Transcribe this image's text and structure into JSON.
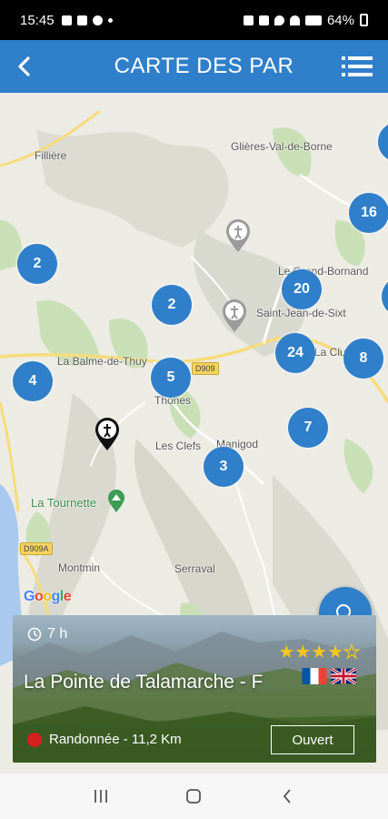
{
  "status_bar": {
    "time": "15:45",
    "battery": "64%"
  },
  "header": {
    "title": "CARTE DES PAR",
    "back_icon": "back-arrow-icon",
    "menu_icon": "list-menu-icon",
    "color": "#2f7fcb"
  },
  "map": {
    "places": [
      "Glières-Val-de-Borne",
      "Fillière",
      "Le Grand-Bornand",
      "Saint-Jean-de-Sixt",
      "La Balme-de-Thuy",
      "Thônes",
      "La Clusaz",
      "Les Clefs",
      "Manigod",
      "La Tournette",
      "Montmin",
      "Serraval"
    ],
    "road_labels": [
      "D909",
      "D909A"
    ],
    "clusters": [
      "2",
      "2",
      "20",
      "16",
      "24",
      "8",
      "4",
      "5",
      "7",
      "3"
    ],
    "attribution": "Google"
  },
  "card": {
    "duration": "7 h",
    "title": "La Pointe de Talamarche - F",
    "rating": 4,
    "rating_max": 5,
    "languages": [
      "fr",
      "en"
    ],
    "activity": "Randonnée - 11,2 Km",
    "status_button": "Ouvert",
    "activity_color": "#d62020"
  },
  "nav": {
    "recent_icon": "recent-apps-icon",
    "home_icon": "home-icon",
    "back_icon": "back-icon"
  }
}
